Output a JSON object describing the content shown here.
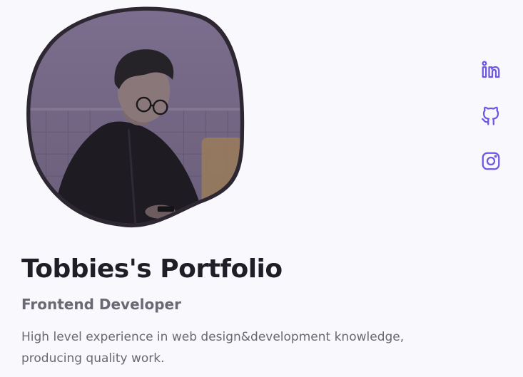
{
  "profile": {
    "photo_alt": "Profile photo of Tobbie",
    "name": "Tobbies's Portfolio",
    "role": "Frontend Developer",
    "description": "High level experience in web design&development knowledge, producing quality work."
  },
  "social": [
    {
      "icon": "linkedin-icon",
      "label": "LinkedIn"
    },
    {
      "icon": "github-icon",
      "label": "GitHub"
    },
    {
      "icon": "instagram-icon",
      "label": "Instagram"
    }
  ],
  "colors": {
    "accent": "#6e57e0",
    "title": "#1f1d26",
    "text": "#6b6773",
    "background": "#f9f8fc",
    "blob_border": "#2d2731"
  }
}
